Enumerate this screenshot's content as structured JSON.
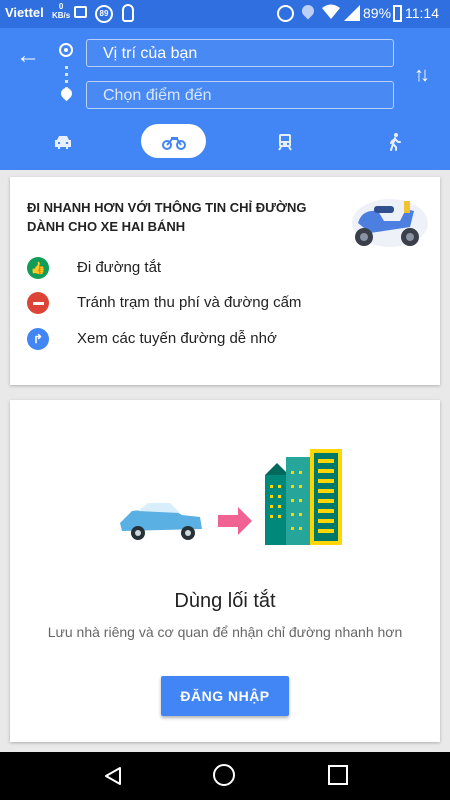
{
  "status_bar": {
    "carrier": "Viettel",
    "speed_value": "0",
    "speed_unit": "KB/s",
    "badge_number": "89",
    "battery_percent": "89%",
    "time": "11:14"
  },
  "directions": {
    "origin_value": "Vị trí của bạn",
    "destination_placeholder": "Chọn điểm đến",
    "travel_modes": [
      "car",
      "motorbike",
      "transit",
      "walking"
    ],
    "selected_mode": "motorbike"
  },
  "promo_card": {
    "title": "ĐI NHANH HƠN VỚI THÔNG TIN CHỈ ĐƯỜNG DÀNH CHO XE HAI BÁNH",
    "features": [
      {
        "icon": "thumbs-up-icon",
        "color": "#0f9d58",
        "label": "Đi đường tắt"
      },
      {
        "icon": "no-entry-icon",
        "color": "#db4437",
        "label": "Tránh trạm thu phí và đường cấm"
      },
      {
        "icon": "route-icon",
        "color": "#4285f4",
        "label": "Xem các tuyến đường dễ nhớ"
      }
    ]
  },
  "shortcut_card": {
    "title": "Dùng lối tắt",
    "subtitle": "Lưu nhà riêng và cơ quan để nhận chỉ đường nhanh hơn",
    "button_label": "ĐĂNG NHẬP"
  },
  "colors": {
    "header": "#4285f4",
    "status_bar": "#2f6fe0",
    "accent": "#4285f4"
  }
}
